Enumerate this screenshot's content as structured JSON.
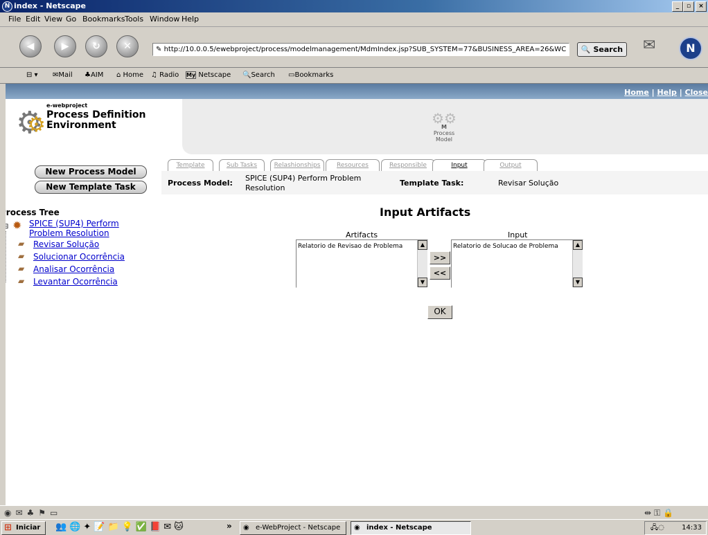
{
  "window": {
    "title": "index - Netscape"
  },
  "menu": [
    "File",
    "Edit",
    "View",
    "Go",
    "Bookmarks",
    "Tools",
    "Window",
    "Help"
  ],
  "nav": {
    "url": "http://10.0.0.5/ewebproject/process/modelmanagement/MdmIndex.jsp?SUB_SYSTEM=77&BUSINESS_AREA=26&WC",
    "search_label": "Search"
  },
  "personal_toolbar": {
    "mail": "Mail",
    "aim": "AIM",
    "home": "Home",
    "radio": "Radio",
    "netscape": "Netscape",
    "search": "Search",
    "bookmarks": "Bookmarks"
  },
  "header": {
    "links": {
      "home": "Home",
      "help": "Help",
      "close": "Close",
      "sep": "|"
    },
    "brand_small": "e-webproject",
    "brand_line1": "Process Definition",
    "brand_line2": "Environment",
    "model_line1": "Process",
    "model_line2": "Model",
    "model_letter": "M"
  },
  "buttons": {
    "new_process_model": "New Process Model",
    "new_template_task": "New Template Task"
  },
  "tabs": [
    "Template",
    "Sub Tasks",
    "Relashionships",
    "Resources",
    "Responsible",
    "Input",
    "Output"
  ],
  "info": {
    "process_model_label": "Process Model:",
    "process_model_value_1": "SPICE (SUP4) Perform Problem",
    "process_model_value_2": "Resolution",
    "template_task_label": "Template Task:",
    "template_task_value": "Revisar Solução"
  },
  "tree": {
    "title": "Process Tree",
    "root_1": "SPICE (SUP4) Perform",
    "root_2": "Problem Resolution",
    "children": [
      "Revisar Solução",
      "Solucionar Ocorrência",
      "Analisar Ocorrência",
      "Levantar Ocorrência"
    ]
  },
  "artifacts": {
    "heading": "Input Artifacts",
    "artifacts_label": "Artifacts",
    "input_label": "Input",
    "artifacts_items": [
      "Relatorio de Revisao de Problema"
    ],
    "input_items": [
      "Relatorio de Solucao de Problema"
    ],
    "add_btn": ">>",
    "remove_btn": "<<",
    "ok_btn": "OK"
  },
  "taskbar": {
    "start": "Iniciar",
    "more": "»",
    "tasks": [
      "e-WebProject - Netscape",
      "index - Netscape"
    ],
    "clock": "14:33"
  }
}
